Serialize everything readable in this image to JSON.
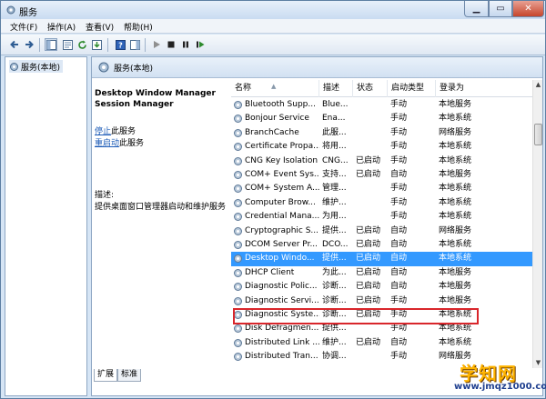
{
  "window": {
    "title": "服务"
  },
  "menu": [
    "文件(F)",
    "操作(A)",
    "查看(V)",
    "帮助(H)"
  ],
  "tree": {
    "root_label": "服务(本地)"
  },
  "content_header": {
    "title": "服务(本地)"
  },
  "detail": {
    "service_title_line1": "Desktop Window Manager",
    "service_title_line2": "Session Manager",
    "stop_link": "停止",
    "stop_suffix": "此服务",
    "restart_link": "重启动",
    "restart_suffix": "此服务",
    "desc_label": "描述:",
    "desc_text": "提供桌面窗口管理器启动和维护服务"
  },
  "grid": {
    "columns": [
      "名称",
      "描述",
      "状态",
      "启动类型",
      "登录为"
    ],
    "rows": [
      {
        "name": "Bluetooth Supp...",
        "desc": "Blue...",
        "status": "",
        "startup": "手动",
        "logon": "本地服务"
      },
      {
        "name": "Bonjour Service",
        "desc": "Ena...",
        "status": "",
        "startup": "手动",
        "logon": "本地系统"
      },
      {
        "name": "BranchCache",
        "desc": "此服...",
        "status": "",
        "startup": "手动",
        "logon": "网络服务"
      },
      {
        "name": "Certificate Propa...",
        "desc": "将用...",
        "status": "",
        "startup": "手动",
        "logon": "本地系统"
      },
      {
        "name": "CNG Key Isolation",
        "desc": "CNG...",
        "status": "已启动",
        "startup": "手动",
        "logon": "本地系统"
      },
      {
        "name": "COM+ Event Sys...",
        "desc": "支持...",
        "status": "已启动",
        "startup": "自动",
        "logon": "本地服务"
      },
      {
        "name": "COM+ System A...",
        "desc": "管理...",
        "status": "",
        "startup": "手动",
        "logon": "本地系统"
      },
      {
        "name": "Computer Brow...",
        "desc": "维护...",
        "status": "",
        "startup": "手动",
        "logon": "本地系统"
      },
      {
        "name": "Credential Mana...",
        "desc": "为用...",
        "status": "",
        "startup": "手动",
        "logon": "本地系统"
      },
      {
        "name": "Cryptographic S...",
        "desc": "提供...",
        "status": "已启动",
        "startup": "自动",
        "logon": "网络服务"
      },
      {
        "name": "DCOM Server Pr...",
        "desc": "DCO...",
        "status": "已启动",
        "startup": "自动",
        "logon": "本地系统"
      },
      {
        "name": "Desktop Windo...",
        "desc": "提供...",
        "status": "已启动",
        "startup": "自动",
        "logon": "本地系统",
        "selected": true
      },
      {
        "name": "DHCP Client",
        "desc": "为此...",
        "status": "已启动",
        "startup": "自动",
        "logon": "本地服务"
      },
      {
        "name": "Diagnostic Polic...",
        "desc": "诊断...",
        "status": "已启动",
        "startup": "自动",
        "logon": "本地服务"
      },
      {
        "name": "Diagnostic Servi...",
        "desc": "诊断...",
        "status": "已启动",
        "startup": "手动",
        "logon": "本地服务"
      },
      {
        "name": "Diagnostic Syste...",
        "desc": "诊断...",
        "status": "已启动",
        "startup": "手动",
        "logon": "本地系统"
      },
      {
        "name": "Disk Defragmen...",
        "desc": "提供...",
        "status": "",
        "startup": "手动",
        "logon": "本地系统"
      },
      {
        "name": "Distributed Link ...",
        "desc": "维护...",
        "status": "已启动",
        "startup": "自动",
        "logon": "本地系统"
      },
      {
        "name": "Distributed Tran...",
        "desc": "协调...",
        "status": "",
        "startup": "手动",
        "logon": "网络服务"
      }
    ]
  },
  "tabs": [
    "扩展",
    "标准"
  ],
  "watermark": {
    "title": "学知网",
    "url": "www.jmqz1000.com"
  },
  "colors": {
    "selection": "#3399ff",
    "highlight_border": "#d9262b",
    "link": "#1c5bb7"
  }
}
